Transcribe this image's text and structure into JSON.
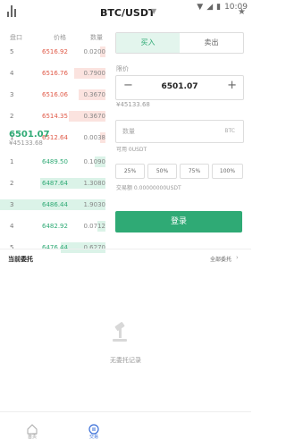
{
  "status": {
    "time": "10:09"
  },
  "header": {
    "pair": "BTC/USDT"
  },
  "orderbook": {
    "headers": [
      "盘口",
      "价格",
      "数量"
    ],
    "asks": [
      {
        "idx": "5",
        "price": "6516.92",
        "qty": "0.0200",
        "depth": 0.05
      },
      {
        "idx": "4",
        "price": "6516.76",
        "qty": "0.7900",
        "depth": 0.3
      },
      {
        "idx": "3",
        "price": "6516.06",
        "qty": "0.3670",
        "depth": 0.25
      },
      {
        "idx": "2",
        "price": "6514.35",
        "qty": "0.3670",
        "depth": 0.35
      },
      {
        "idx": "1",
        "price": "6512.64",
        "qty": "0.0038",
        "depth": 0.05
      }
    ],
    "last_price": "6501.07",
    "last_price_cny": "¥45133.68",
    "bids": [
      {
        "idx": "1",
        "price": "6489.50",
        "qty": "0.1090",
        "depth": 0.1
      },
      {
        "idx": "2",
        "price": "6487.64",
        "qty": "1.3080",
        "depth": 0.62
      },
      {
        "idx": "3",
        "price": "6486.44",
        "qty": "1.9030",
        "depth": 1.0
      },
      {
        "idx": "4",
        "price": "6482.92",
        "qty": "0.0712",
        "depth": 0.08
      },
      {
        "idx": "5",
        "price": "6476.44",
        "qty": "0.6270",
        "depth": 0.42
      }
    ],
    "colors": {
      "ask": "#e05a48",
      "bid": "#2faa75"
    }
  },
  "trade": {
    "tab_buy": "买入",
    "tab_sell": "卖出",
    "price_label": "限价",
    "price_value": "6501.07",
    "price_cny": "¥45133.68",
    "qty_placeholder": "数量",
    "qty_unit": "BTC",
    "available": "可用 0USDT",
    "percents": [
      "25%",
      "50%",
      "75%",
      "100%"
    ],
    "turnover": "交易额 0.00000000USDT",
    "submit": "登录",
    "accent": "#2faa75"
  },
  "orders": {
    "title": "当前委托",
    "all": "全部委托",
    "empty": "无委托记录"
  },
  "nav": {
    "items": [
      "首页",
      "交易"
    ]
  }
}
